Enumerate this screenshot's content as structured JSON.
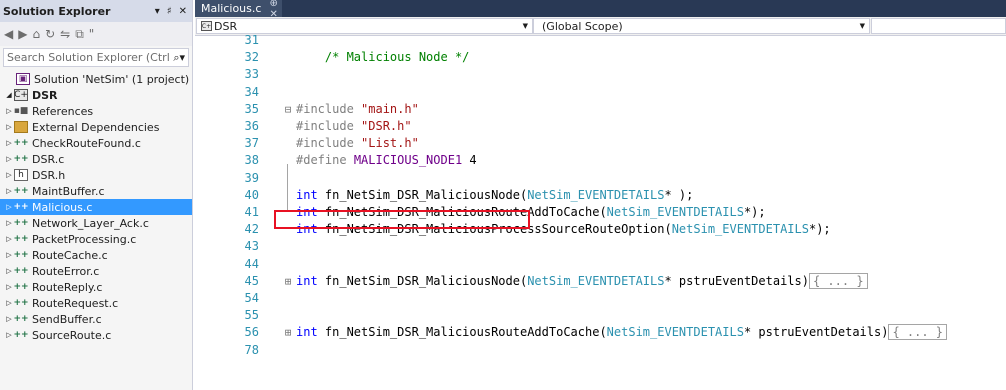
{
  "solution_explorer": {
    "title": "Solution Explorer",
    "header_icons": [
      "▾",
      "♯",
      "✕"
    ],
    "toolbar_icons": [
      "◀",
      "▶",
      "⌂",
      "↻",
      "⇋",
      "⧉",
      "\""
    ],
    "search_placeholder": "Search Solution Explorer (Ctrl",
    "solution_label": "Solution 'NetSim' (1 project)",
    "project_label": "DSR",
    "items": [
      {
        "label": "References",
        "icon": "references-icon"
      },
      {
        "label": "External Dependencies",
        "icon": "folder-icon"
      },
      {
        "label": "CheckRouteFound.c",
        "icon": "c-file-icon"
      },
      {
        "label": "DSR.c",
        "icon": "c-file-icon"
      },
      {
        "label": "DSR.h",
        "icon": "h-file-icon"
      },
      {
        "label": "MaintBuffer.c",
        "icon": "c-file-icon"
      },
      {
        "label": "Malicious.c",
        "icon": "c-file-icon",
        "selected": true
      },
      {
        "label": "Network_Layer_Ack.c",
        "icon": "c-file-icon"
      },
      {
        "label": "PacketProcessing.c",
        "icon": "c-file-icon"
      },
      {
        "label": "RouteCache.c",
        "icon": "c-file-icon"
      },
      {
        "label": "RouteError.c",
        "icon": "c-file-icon"
      },
      {
        "label": "RouteReply.c",
        "icon": "c-file-icon"
      },
      {
        "label": "RouteRequest.c",
        "icon": "c-file-icon"
      },
      {
        "label": "SendBuffer.c",
        "icon": "c-file-icon"
      },
      {
        "label": "SourceRoute.c",
        "icon": "c-file-icon"
      }
    ]
  },
  "editor": {
    "tab_label": "Malicious.c",
    "tab_icons": "⊕ ✕",
    "nav_project": "DSR",
    "nav_scope": "(Global Scope)",
    "nav_member": ""
  },
  "code_lines": [
    {
      "n": "31",
      "html": ""
    },
    {
      "n": "32",
      "html": "    <span class=\"cm\">/* Malicious Node */</span>"
    },
    {
      "n": "33",
      "html": ""
    },
    {
      "n": "34",
      "html": ""
    },
    {
      "n": "35",
      "gut": "⊟",
      "html": "<span class=\"pp\">#include</span> <span class=\"str\">\"main.h\"</span>"
    },
    {
      "n": "36",
      "html": "<span class=\"pp\">#include</span> <span class=\"str\">\"DSR.h\"</span>"
    },
    {
      "n": "37",
      "html": "<span class=\"pp\">#include</span> <span class=\"str\">\"List.h\"</span>"
    },
    {
      "n": "38",
      "html": "<span class=\"pp\">#define</span> <span class=\"mac\">MALICIOUS_NODE1</span> 4"
    },
    {
      "n": "39",
      "html": ""
    },
    {
      "n": "40",
      "html": "<span class=\"kw\">int</span> fn_NetSim_DSR_MaliciousNode(<span class=\"ty\">NetSim_EVENTDETAILS</span>* );"
    },
    {
      "n": "41",
      "html": "<span class=\"kw\">int</span> fn_NetSim_DSR_MaliciousRouteAddToCache(<span class=\"ty\">NetSim_EVENTDETAILS</span>*);"
    },
    {
      "n": "42",
      "html": "<span class=\"kw\">int</span> fn_NetSim_DSR_MaliciousProcessSourceRouteOption(<span class=\"ty\">NetSim_EVENTDETAILS</span>*);"
    },
    {
      "n": "43",
      "html": ""
    },
    {
      "n": "44",
      "html": ""
    },
    {
      "n": "45",
      "gut": "⊞",
      "html": "<span class=\"kw\">int</span> fn_NetSim_DSR_MaliciousNode(<span class=\"ty\">NetSim_EVENTDETAILS</span>* pstruEventDetails)<span class=\"collapsed\">{ ... }</span>"
    },
    {
      "n": "54",
      "html": ""
    },
    {
      "n": "55",
      "html": ""
    },
    {
      "n": "56",
      "gut": "⊞",
      "html": "<span class=\"kw\">int</span> fn_NetSim_DSR_MaliciousRouteAddToCache(<span class=\"ty\">NetSim_EVENTDETAILS</span>* pstruEventDetails)<span class=\"collapsed\">{ ... }</span>"
    },
    {
      "n": "78",
      "html": ""
    }
  ]
}
